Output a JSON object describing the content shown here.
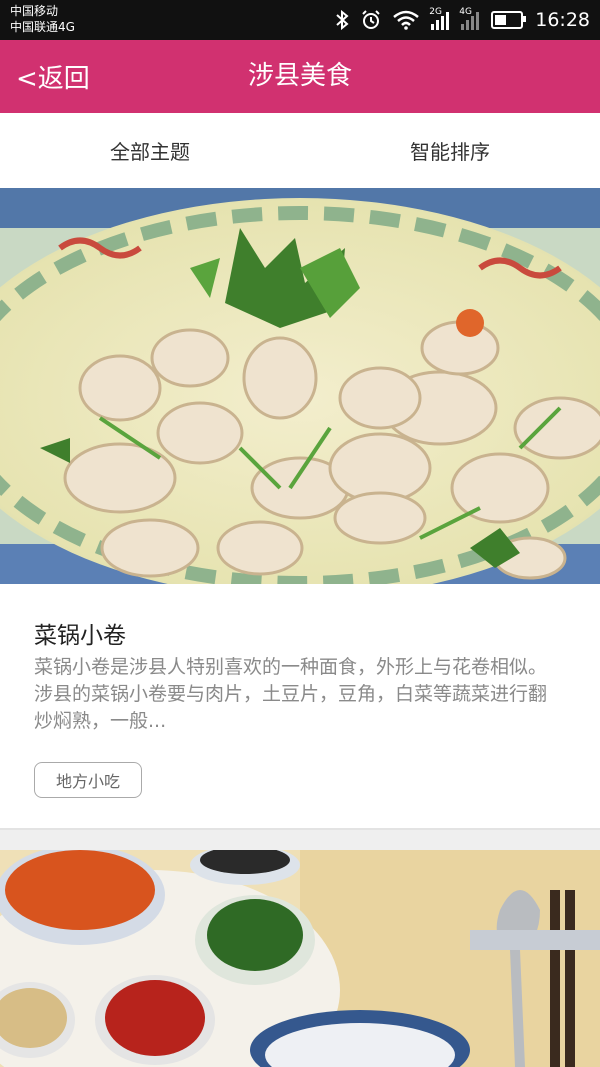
{
  "status_bar": {
    "carrier_1": "中国移动",
    "carrier_2": "中国联通4G",
    "network_1": "2G",
    "network_2": "4G",
    "time": "16:28",
    "battery_level": 0.45
  },
  "header": {
    "back_label": "<返回",
    "title": "涉县美食"
  },
  "filters": {
    "all_topics": "全部主题",
    "smart_sort": "智能排序"
  },
  "items": [
    {
      "title": "菜锅小卷",
      "description": "菜锅小卷是涉县人特别喜欢的一种面食，外形上与花卷相似。涉县的菜锅小卷要与肉片，土豆片，豆角，白菜等蔬菜进行翻炒焖熟，一般...",
      "tag": "地方小吃"
    }
  ],
  "colors": {
    "accent": "#d13170",
    "status_bar": "#111111",
    "background": "#efefef"
  }
}
